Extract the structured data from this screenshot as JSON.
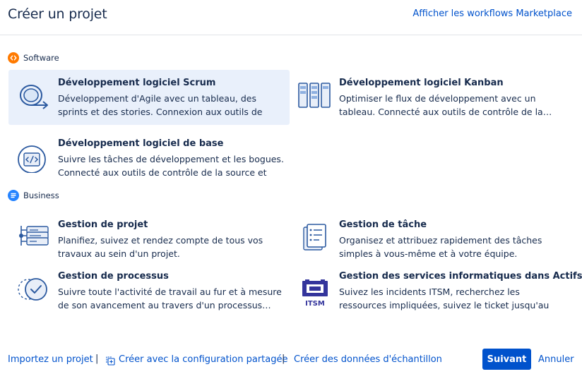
{
  "header": {
    "title": "Créer un projet",
    "marketplace_link": "Afficher les workflows Marketplace"
  },
  "sections": {
    "software": {
      "label": "Software",
      "badge_color": "#ff7a00"
    },
    "business": {
      "label": "Business",
      "badge_color": "#2684ff"
    }
  },
  "templates": {
    "scrum": {
      "name": "Développement logiciel Scrum",
      "desc": "Développement d'Agile avec un tableau, des sprints et des stories. Connexion aux outils de contrôle de…",
      "icon": "scrum-cycle-icon"
    },
    "kanban": {
      "name": "Développement logiciel Kanban",
      "desc": "Optimiser le flux de développement avec un tableau. Connecté aux outils de contrôle de la…",
      "icon": "kanban-board-icon"
    },
    "basic": {
      "name": "Développement logiciel de base",
      "desc": "Suivre les tâches de développement et les bogues. Connecté aux outils de contrôle de la source et du…",
      "icon": "code-icon"
    },
    "project": {
      "name": "Gestion de projet",
      "desc": "Planifiez, suivez et rendez compte de tous vos travaux au sein d'un projet.",
      "icon": "project-list-icon"
    },
    "task": {
      "name": "Gestion de tâche",
      "desc": "Organisez et attribuez rapidement des tâches simples à vous-même et à votre équipe.",
      "icon": "task-cards-icon"
    },
    "process": {
      "name": "Gestion de processus",
      "desc": "Suivre toute l'activité de travail au fur et à mesure de son avancement au travers d'un processus…",
      "icon": "process-check-icon"
    },
    "itsm": {
      "name": "Gestion des services informatiques dans Actifs",
      "desc": "Suivez les incidents ITSM, recherchez les ressources impliquées, suivez le ticket jusqu'au problème de…",
      "icon": "itsm-logo-icon",
      "icon_text": "ITSM"
    }
  },
  "footer": {
    "import_link": "Importez un projet",
    "shared_config_link": "Créer avec la configuration partagée",
    "sample_data_link": "Créer des données d'échantillon",
    "next_button": "Suivant",
    "cancel_button": "Annuler",
    "primary_color": "#0052cc"
  }
}
